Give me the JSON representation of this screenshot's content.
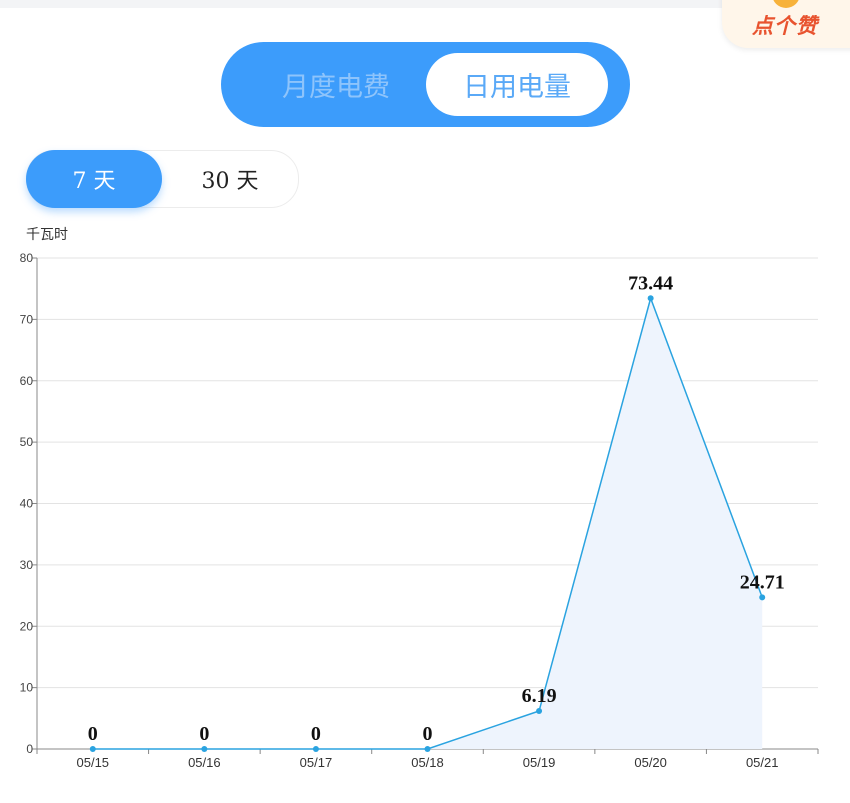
{
  "header": {
    "like_label": "点个赞"
  },
  "tabs": [
    {
      "label": "月度电费",
      "selected": false
    },
    {
      "label": "日用电量",
      "selected": true
    }
  ],
  "range": {
    "options": [
      "7 天",
      "30 天"
    ],
    "selected": "7 天"
  },
  "colors": {
    "accent": "#3c9cfb",
    "line": "#2aa3e0",
    "area": "#eef4fd",
    "like": "#e8532f"
  },
  "chart_data": {
    "type": "area",
    "ylabel": "千瓦时",
    "categories": [
      "05/15",
      "05/16",
      "05/17",
      "05/18",
      "05/19",
      "05/20",
      "05/21"
    ],
    "values": [
      0,
      0,
      0,
      0,
      6.19,
      73.44,
      24.71
    ],
    "data_labels": [
      "0",
      "0",
      "0",
      "0",
      "6.19",
      "73.44",
      "24.71"
    ],
    "ylim": [
      0,
      80
    ],
    "yticks": [
      "0",
      "10",
      "20",
      "30",
      "40",
      "50",
      "60",
      "70",
      "80"
    ],
    "grid": true,
    "legend": "none"
  }
}
